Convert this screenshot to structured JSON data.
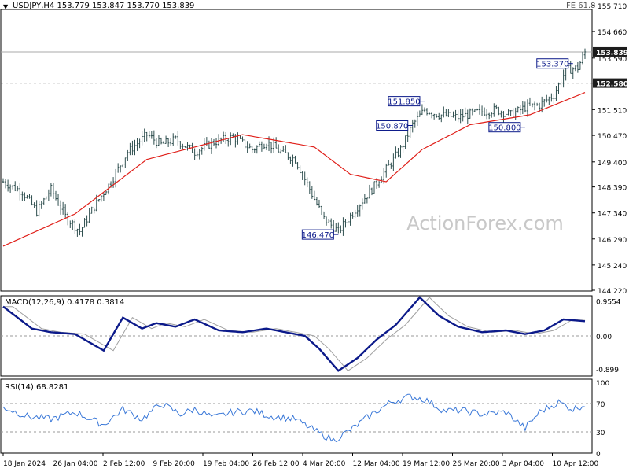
{
  "header": {
    "symbol_info": "USDJPY,H4  153.779 153.847 153.770 153.839",
    "fe_label": "FE 61.8"
  },
  "watermark": "ActionForex.com",
  "colors": {
    "bars": "#2f4f4f",
    "ma": "#e0201a",
    "macd": "#0c1a8a",
    "signal": "#a0a0a0",
    "rsi": "#3a78d8",
    "grid": "#9a9a9a",
    "price_tag_bg": "#1c1c1c",
    "label_border": "#0c1a8a"
  },
  "chart_data": [
    {
      "type": "candlestick",
      "name": "price",
      "y_ticks": [
        155.71,
        154.66,
        153.59,
        152.58,
        151.51,
        150.47,
        149.4,
        148.39,
        147.34,
        146.29,
        145.24,
        144.22
      ],
      "ylim": [
        144.22,
        155.71
      ],
      "current_price": 153.839,
      "horizontal_levels": [
        {
          "value": 153.839,
          "style": "solid",
          "label": "153.839"
        },
        {
          "value": 152.58,
          "style": "dashed",
          "label": "152.580"
        }
      ],
      "annotations": [
        {
          "label": "150.870",
          "value": 150.87
        },
        {
          "label": "146.470",
          "value": 146.47
        },
        {
          "label": "151.850",
          "value": 151.85
        },
        {
          "label": "150.800",
          "value": 150.8
        },
        {
          "label": "153.370",
          "value": 153.37
        }
      ],
      "x_labels": [
        "18 Jan 2024",
        "26 Jan 04:00",
        "2 Feb 12:00",
        "9 Feb 20:00",
        "19 Feb 04:00",
        "26 Feb 12:00",
        "4 Mar 20:00",
        "12 Mar 04:00",
        "19 Mar 12:00",
        "26 Mar 20:00",
        "3 Apr 04:00",
        "10 Apr 12:00"
      ],
      "keypoints": [
        [
          0,
          148.6
        ],
        [
          8,
          148.2
        ],
        [
          14,
          147.4
        ],
        [
          20,
          148.3
        ],
        [
          26,
          147.2
        ],
        [
          32,
          146.6
        ],
        [
          38,
          147.6
        ],
        [
          45,
          148.6
        ],
        [
          52,
          149.8
        ],
        [
          60,
          150.5
        ],
        [
          66,
          150.1
        ],
        [
          72,
          150.3
        ],
        [
          80,
          149.8
        ],
        [
          88,
          150.2
        ],
        [
          96,
          150.4
        ],
        [
          104,
          149.9
        ],
        [
          110,
          150.2
        ],
        [
          116,
          149.8
        ],
        [
          122,
          149.5
        ],
        [
          128,
          148.3
        ],
        [
          134,
          147.1
        ],
        [
          140,
          146.6
        ],
        [
          148,
          147.6
        ],
        [
          154,
          148.3
        ],
        [
          160,
          149.1
        ],
        [
          166,
          149.9
        ],
        [
          171,
          150.9
        ],
        [
          176,
          151.5
        ],
        [
          182,
          151.3
        ],
        [
          190,
          151.2
        ],
        [
          198,
          151.4
        ],
        [
          206,
          151.5
        ],
        [
          212,
          151.3
        ],
        [
          218,
          151.6
        ],
        [
          224,
          151.7
        ],
        [
          230,
          152.1
        ],
        [
          235,
          153.1
        ],
        [
          240,
          153.2
        ],
        [
          243,
          153.839
        ]
      ],
      "ma_keypoints": [
        [
          0,
          146.0
        ],
        [
          30,
          147.3
        ],
        [
          60,
          149.5
        ],
        [
          100,
          150.5
        ],
        [
          130,
          150.0
        ],
        [
          145,
          148.9
        ],
        [
          160,
          148.6
        ],
        [
          175,
          149.9
        ],
        [
          195,
          150.9
        ],
        [
          220,
          151.3
        ],
        [
          243,
          152.2
        ]
      ]
    },
    {
      "type": "line",
      "name": "MACD(12,26,9)",
      "header": "MACD(12,26,9)  0.4178  0.3814",
      "values_shown": [
        0.4178,
        0.3814
      ],
      "y_ticks": [
        0.9554,
        0.0,
        -0.899
      ],
      "y_tick_labels": [
        "0.9554",
        "0.00",
        "-0.899"
      ],
      "ylim": [
        -1.05,
        1.05
      ],
      "macd_keypoints": [
        [
          0,
          0.8
        ],
        [
          12,
          0.2
        ],
        [
          20,
          0.1
        ],
        [
          30,
          0.05
        ],
        [
          42,
          -0.4
        ],
        [
          50,
          0.5
        ],
        [
          58,
          0.2
        ],
        [
          64,
          0.35
        ],
        [
          72,
          0.25
        ],
        [
          80,
          0.45
        ],
        [
          90,
          0.15
        ],
        [
          100,
          0.1
        ],
        [
          110,
          0.2
        ],
        [
          118,
          0.1
        ],
        [
          126,
          0.0
        ],
        [
          132,
          -0.35
        ],
        [
          140,
          -0.95
        ],
        [
          148,
          -0.6
        ],
        [
          156,
          -0.1
        ],
        [
          164,
          0.3
        ],
        [
          174,
          1.05
        ],
        [
          182,
          0.55
        ],
        [
          190,
          0.25
        ],
        [
          200,
          0.1
        ],
        [
          210,
          0.15
        ],
        [
          218,
          0.05
        ],
        [
          226,
          0.15
        ],
        [
          234,
          0.45
        ],
        [
          243,
          0.4
        ]
      ],
      "signal_lag": 4
    },
    {
      "type": "line",
      "name": "RSI(14)",
      "header": "RSI(14)  68.8281",
      "values_shown": [
        68.8281
      ],
      "y_ticks": [
        100,
        70,
        30,
        0
      ],
      "levels": [
        70,
        30
      ],
      "ylim": [
        0,
        100
      ],
      "rsi_keypoints": [
        [
          0,
          65
        ],
        [
          10,
          52
        ],
        [
          20,
          48
        ],
        [
          30,
          58
        ],
        [
          42,
          40
        ],
        [
          50,
          62
        ],
        [
          58,
          48
        ],
        [
          66,
          70
        ],
        [
          74,
          55
        ],
        [
          80,
          62
        ],
        [
          88,
          50
        ],
        [
          96,
          58
        ],
        [
          104,
          60
        ],
        [
          112,
          52
        ],
        [
          122,
          48
        ],
        [
          130,
          32
        ],
        [
          138,
          18
        ],
        [
          146,
          35
        ],
        [
          154,
          55
        ],
        [
          162,
          72
        ],
        [
          170,
          80
        ],
        [
          176,
          76
        ],
        [
          184,
          60
        ],
        [
          192,
          60
        ],
        [
          200,
          55
        ],
        [
          210,
          58
        ],
        [
          218,
          35
        ],
        [
          224,
          58
        ],
        [
          232,
          72
        ],
        [
          238,
          62
        ],
        [
          243,
          68.8
        ]
      ]
    }
  ]
}
